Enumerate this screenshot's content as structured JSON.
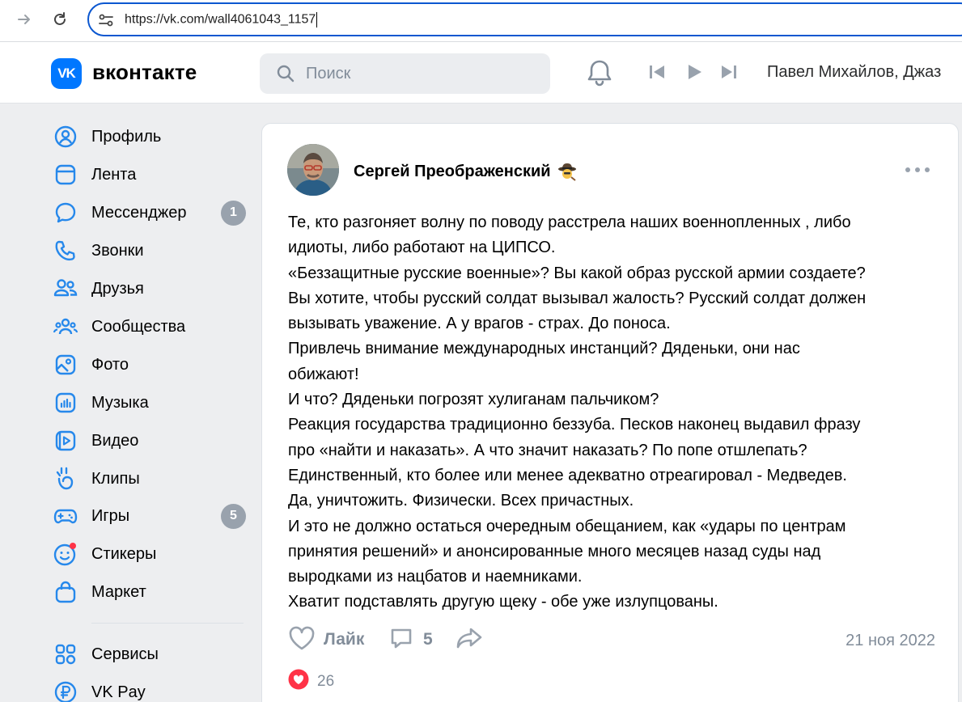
{
  "browser": {
    "url": "https://vk.com/wall4061043_1157"
  },
  "header": {
    "logo": "VK",
    "brand": "вконтакте",
    "search_placeholder": "Поиск",
    "now_playing": "Павел Михайлов, Джаз"
  },
  "sidebar": {
    "items": [
      {
        "label": "Профиль",
        "icon": "profile-icon"
      },
      {
        "label": "Лента",
        "icon": "feed-icon"
      },
      {
        "label": "Мессенджер",
        "icon": "messenger-icon",
        "badge": "1"
      },
      {
        "label": "Звонки",
        "icon": "phone-icon"
      },
      {
        "label": "Друзья",
        "icon": "friends-icon"
      },
      {
        "label": "Сообщества",
        "icon": "communities-icon"
      },
      {
        "label": "Фото",
        "icon": "photo-icon"
      },
      {
        "label": "Музыка",
        "icon": "music-icon"
      },
      {
        "label": "Видео",
        "icon": "video-icon"
      },
      {
        "label": "Клипы",
        "icon": "clips-icon"
      },
      {
        "label": "Игры",
        "icon": "games-icon",
        "badge": "5"
      },
      {
        "label": "Стикеры",
        "icon": "stickers-icon"
      },
      {
        "label": "Маркет",
        "icon": "market-icon"
      },
      {
        "label": "Сервисы",
        "icon": "services-icon"
      },
      {
        "label": "VK Pay",
        "icon": "vkpay-icon"
      }
    ]
  },
  "post": {
    "author": "Сергей Преображенский",
    "lines": [
      "Те, кто разгоняет волну по поводу расстрела наших военнопленных , либо",
      "идиоты, либо работают на ЦИПСО.",
      "«Беззащитные русские военные»? Вы какой образ русской армии создаете?",
      "Вы хотите, чтобы русский солдат вызывал жалость? Русский солдат должен",
      "вызывать уважение. А у врагов - страх. До поноса.",
      "Привлечь внимание международных инстанций? Дяденьки, они нас",
      "обижают!",
      "И что? Дяденьки погрозят хулиганам пальчиком?",
      "Реакция государства традиционно беззуба. Песков наконец выдавил фразу",
      "про «найти и наказать». А что значит наказать? По попе отшлепать?",
      "Единственный, кто более или менее адекватно отреагировал - Медведев.",
      "Да, уничтожить. Физически. Всех причастных.",
      "И это не должно остаться очередным обещанием, как «удары по центрам",
      "принятия решений» и анонсированные много месяцев назад суды над",
      "выродками из нацбатов и наемниками.",
      "Хватит подставлять другую щеку - обе уже излупцованы."
    ],
    "like_label": "Лайк",
    "comments_count": "5",
    "date": "21 ноя 2022",
    "reactions_count": "26"
  },
  "colors": {
    "vk_blue": "#0077ff",
    "muted": "#818c99",
    "icon_blue": "#2688eb",
    "badge_gray": "#99a2ad",
    "reaction_red": "#ff3347"
  }
}
